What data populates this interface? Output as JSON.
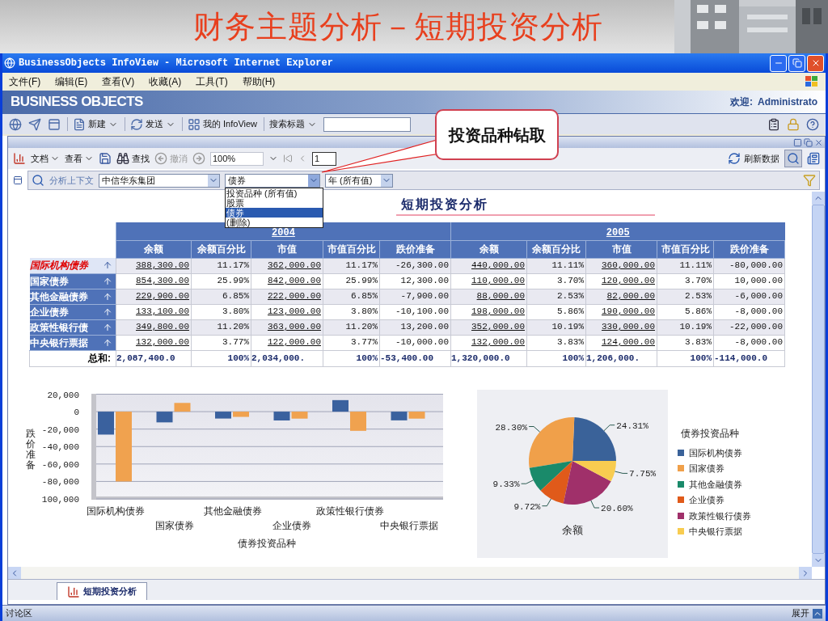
{
  "slide_title": "财务主题分析－短期投资分析",
  "window": {
    "title": "BusinessObjects InfoView - Microsoft Internet Explorer"
  },
  "menu": [
    "文件(F)",
    "编辑(E)",
    "查看(V)",
    "收藏(A)",
    "工具(T)",
    "帮助(H)"
  ],
  "header": {
    "logo": "BUSINESS OBJECTS",
    "welcome": "欢迎:",
    "user": "Administrato"
  },
  "toolbar": [
    {
      "label": "新建",
      "dropdown": true
    },
    {
      "label": "发送",
      "dropdown": true
    },
    {
      "label": "我的 InfoView",
      "dropdown": false
    },
    {
      "label": "搜索标题",
      "dropdown": true
    }
  ],
  "doc_toolbar": {
    "document": "文档",
    "view": "查看",
    "find": "查找",
    "undo": {
      "label": "撤消",
      "disabled": true
    },
    "zoom": "100%",
    "page": "1",
    "refresh": "刷新数据",
    "analysis_pressed": true
  },
  "analysis": {
    "label": "分析上下文",
    "filters": [
      {
        "value": "中信华东集团",
        "open": false
      },
      {
        "value": "债券",
        "open": true,
        "options": [
          {
            "label": "投资品种 (所有值)",
            "selected": false
          },
          {
            "label": "股票",
            "selected": false
          },
          {
            "label": "债券",
            "selected": true
          },
          {
            "label": "(删除)",
            "selected": false
          }
        ]
      },
      {
        "value": "年 (所有值)",
        "open": false
      }
    ]
  },
  "callout": "投资品种钻取",
  "report": {
    "title": "短期投资分析",
    "table": {
      "groups": [
        {
          "label": "2004",
          "columns": [
            {
              "label": "余额",
              "link": true
            },
            {
              "label": "余额百分比",
              "link": false
            },
            {
              "label": "市值",
              "link": true
            },
            {
              "label": "市值百分比",
              "link": false
            },
            {
              "label": "跌价准备",
              "link": false
            }
          ]
        },
        {
          "label": "2005",
          "columns": [
            {
              "label": "余额",
              "link": true
            },
            {
              "label": "余额百分比",
              "link": false
            },
            {
              "label": "市值",
              "link": true
            },
            {
              "label": "市值百分比",
              "link": false
            },
            {
              "label": "跌价准备",
              "link": false
            }
          ]
        }
      ],
      "rows": [
        {
          "label": "国际机构债券",
          "highlighted": true,
          "cells": [
            "388,300.00",
            "11.17%",
            "362,000.00",
            "11.17%",
            "-26,300.00",
            "440,000.00",
            "11.11%",
            "360,000.00",
            "11.11%",
            "-80,000.00"
          ]
        },
        {
          "label": "国家债券",
          "highlighted": false,
          "cells": [
            "854,300.00",
            "25.99%",
            "842,000.00",
            "25.99%",
            "12,300.00",
            "110,000.00",
            "3.70%",
            "120,000.00",
            "3.70%",
            "10,000.00"
          ]
        },
        {
          "label": "其他金融债券",
          "highlighted": false,
          "cells": [
            "229,900.00",
            "6.85%",
            "222,000.00",
            "6.85%",
            "-7,900.00",
            "88,000.00",
            "2.53%",
            "82,000.00",
            "2.53%",
            "-6,000.00"
          ]
        },
        {
          "label": "企业债券",
          "highlighted": false,
          "cells": [
            "133,100.00",
            "3.80%",
            "123,000.00",
            "3.80%",
            "-10,100.00",
            "198,000.00",
            "5.86%",
            "190,000.00",
            "5.86%",
            "-8,000.00"
          ]
        },
        {
          "label": "政策性银行债",
          "highlighted": false,
          "cells": [
            "349,800.00",
            "11.20%",
            "363,000.00",
            "11.20%",
            "13,200.00",
            "352,000.00",
            "10.19%",
            "330,000.00",
            "10.19%",
            "-22,000.00"
          ]
        },
        {
          "label": "中央银行票据",
          "highlighted": false,
          "cells": [
            "132,000.00",
            "3.77%",
            "122,000.00",
            "3.77%",
            "-10,000.00",
            "132,000.00",
            "3.83%",
            "124,000.00",
            "3.83%",
            "-8,000.00"
          ]
        }
      ],
      "total": {
        "label": "总和:",
        "cells": [
          "2,087,400.0",
          "100%",
          "2,034,000.",
          "100%",
          "-53,400.00",
          "1,320,000.0",
          "100%",
          "1,206,000.",
          "100%",
          "-114,000.0"
        ]
      }
    },
    "bar_chart": {
      "chart_data": {
        "type": "bar",
        "xlabel": "债券投资品种",
        "ylabel": "跌价准备",
        "categories": [
          "国际机构债券",
          "国家债券",
          "其他金融债券",
          "企业债券",
          "政策性银行债券",
          "中央银行票据"
        ],
        "grid": true,
        "series": [
          {
            "color": "#3a619e",
            "values": [
              -26300,
              -12300,
              -7900,
              -10100,
              13200,
              -10000
            ]
          },
          {
            "color": "#f0a24f",
            "values": [
              -80000,
              10000,
              -6000,
              -8000,
              -22000,
              -8000
            ]
          }
        ],
        "ylim": [
          -100000,
          20000
        ],
        "yticks": [
          {
            "value": 20000,
            "label": "20,000"
          },
          {
            "value": 0,
            "label": "0"
          },
          {
            "value": -20000,
            "label": "-20,000"
          },
          {
            "value": -40000,
            "label": "-40,000"
          },
          {
            "value": -60000,
            "label": "-60,000"
          },
          {
            "value": -80000,
            "label": "-80,000"
          },
          {
            "value": -100000,
            "label": "100,000"
          }
        ]
      }
    },
    "pie_chart": {
      "chart_data": {
        "type": "pie",
        "title": "余额",
        "categories": [
          "国际机构债券",
          "国家债券",
          "其他金融债券",
          "企业债券",
          "政策性银行债券",
          "中央银行票据"
        ],
        "series": [
          {
            "values": [
              24.31,
              28.3,
              9.33,
              9.72,
              20.6,
              7.75
            ]
          }
        ],
        "value_labels": [
          "24.31%",
          "28.30%",
          "9.33%",
          "9.72%",
          "20.60%",
          "7.75%"
        ],
        "colors": [
          "#3a6299",
          "#f0a04a",
          "#1a8a6a",
          "#e05a1a",
          "#a0306a",
          "#f8cc50"
        ]
      },
      "legend_title": "债券投资品种"
    }
  },
  "tabs": [
    {
      "label": "短期投资分析",
      "selected": true
    }
  ],
  "status_bar": {
    "left": "讨论区",
    "right": "展开"
  }
}
